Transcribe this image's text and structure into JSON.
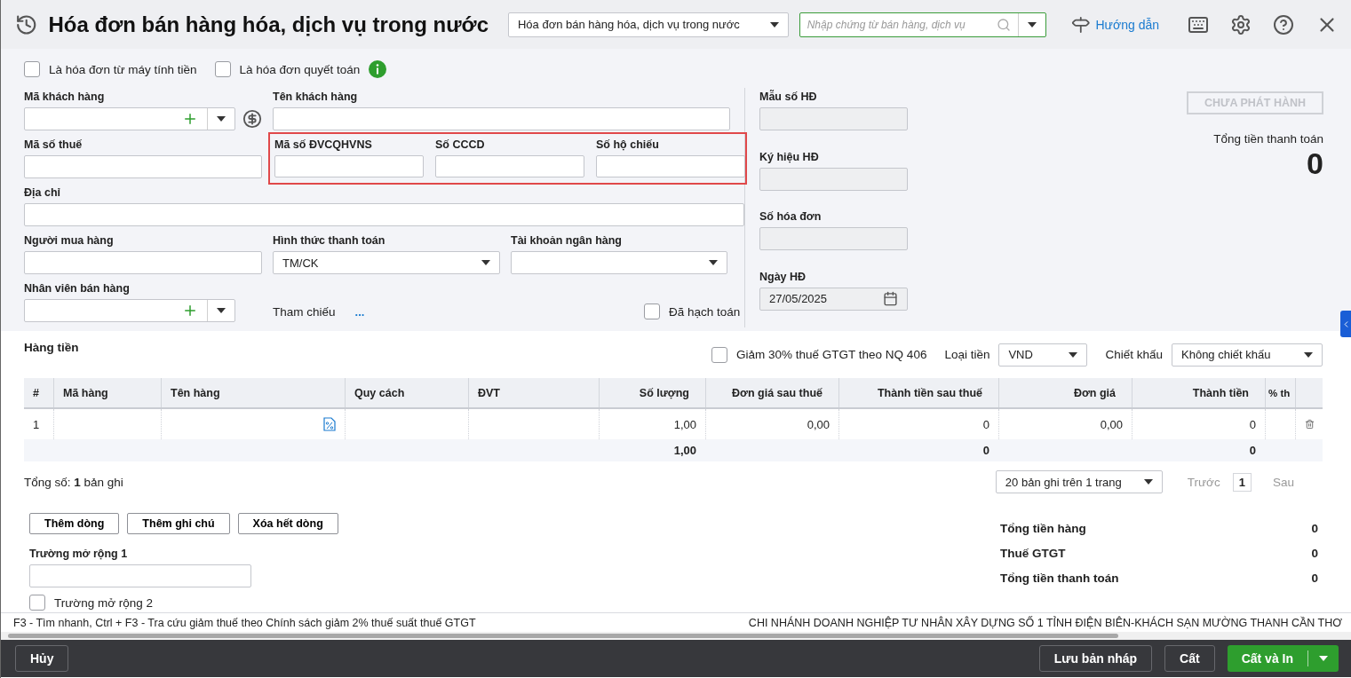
{
  "header": {
    "title": "Hóa đơn bán hàng hóa, dịch vụ trong nước",
    "document_type": "Hóa đơn bán hàng hóa, dịch vụ trong nước",
    "search": {
      "placeholder": "Nhập chứng từ bán hàng, dịch vụ"
    },
    "help_link": "Hướng dẫn"
  },
  "options": [
    {
      "label": "Là hóa đơn từ máy tính tiền",
      "checked": false,
      "has_info": false
    },
    {
      "label": "Là hóa đơn quyết toán",
      "checked": false,
      "has_info": true
    }
  ],
  "customer_code": {
    "label": "Mã khách hàng"
  },
  "customer_name": {
    "label": "Tên khách hàng"
  },
  "tax_code": {
    "label": "Mã số thuế"
  },
  "highlighted_fields": [
    {
      "label": "Mã số ĐVCQHVNS"
    },
    {
      "label": "Số CCCD"
    },
    {
      "label": "Số hộ chiếu"
    }
  ],
  "address": {
    "label": "Địa chỉ"
  },
  "buyer": {
    "label": "Người mua hàng"
  },
  "payment_method": {
    "label": "Hình thức thanh toán",
    "value": "TM/CK"
  },
  "bank_account": {
    "label": "Tài khoản ngân hàng"
  },
  "salesperson": {
    "label": "Nhân viên bán hàng"
  },
  "reference": {
    "label": "Tham chiếu",
    "link": "..."
  },
  "posted": {
    "label": "Đã hạch toán",
    "checked": false
  },
  "invoice_info": [
    {
      "label": "Mẫu số HĐ",
      "kind": "text"
    },
    {
      "label": "Ký hiệu HĐ",
      "kind": "text"
    },
    {
      "label": "Số hóa đơn",
      "kind": "text"
    },
    {
      "label": "Ngày HĐ",
      "kind": "date",
      "value": "27/05/2025"
    }
  ],
  "status_button": {
    "label": "CHƯA PHÁT HÀNH",
    "disabled": true
  },
  "total": {
    "label": "Tổng tiền thanh toán",
    "value": "0"
  },
  "items": {
    "title": "Hàng tiền",
    "vat_reduction": {
      "label": "Giảm 30% thuế GTGT theo NQ 406",
      "checked": false
    },
    "currency": {
      "label": "Loại tiền",
      "value": "VND"
    },
    "discount": {
      "label": "Chiết khấu",
      "value": "Không chiết khấu"
    },
    "columns": [
      "#",
      "Mã hàng",
      "Tên hàng",
      "Quy cách",
      "ĐVT",
      "Số lượng",
      "Đơn giá sau thuế",
      "Thành tiền sau thuế",
      "Đơn giá",
      "Thành tiền",
      "% th"
    ],
    "rows": [
      {
        "cells": [
          "1",
          null,
          null,
          null,
          null,
          "1,00",
          "0,00",
          "0",
          "0,00",
          "0",
          null
        ]
      }
    ],
    "totals": [
      "1,00",
      "0",
      "0"
    ],
    "record_count": "Tổng số: **1** bản ghi",
    "page_size": "20 bản ghi trên 1 trang",
    "prev": "Trước",
    "page": "1",
    "next": "Sau"
  },
  "actions": [
    "Thêm dòng",
    "Thêm ghi chú",
    "Xóa hết dòng"
  ],
  "extra_fields": [
    {
      "label": "Trường mở rộng 1",
      "kind": "text"
    },
    {
      "label": "Trường mở rộng 2",
      "kind": "checkbox",
      "checked": false
    }
  ],
  "summary": [
    {
      "label": "Tổng tiền hàng",
      "value": "0"
    },
    {
      "label": "Thuế GTGT",
      "value": "0"
    },
    {
      "label": "Tổng tiền thanh toán",
      "value": "0"
    }
  ],
  "status_bar": {
    "hint": "F3 - Tìm nhanh, Ctrl + F3 - Tra cứu giảm thuế theo Chính sách giảm 2% thuế suất thuế GTGT",
    "company": "CHI NHÁNH DOANH NGHIỆP TƯ NHÂN XÂY DỰNG SỐ 1 TỈNH ĐIỆN BIÊN-KHÁCH SẠN MƯỜNG THANH CẦN THƠ"
  },
  "footer": {
    "cancel": "Hủy",
    "buttons": [
      "Lưu bản nháp",
      "Cất"
    ],
    "primary": "Cất và In"
  }
}
